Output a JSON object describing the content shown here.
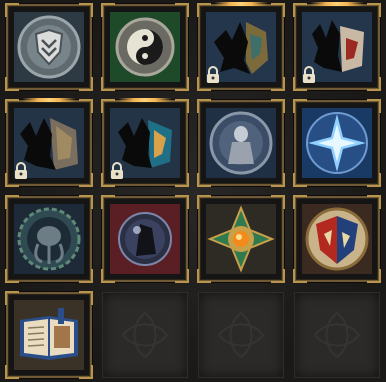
{
  "collection": {
    "slots": [
      {
        "icon": "shield-emblem-icon",
        "locked": false
      },
      {
        "icon": "yin-yang-icon",
        "locked": false
      },
      {
        "icon": "dragon-silhouette-icon",
        "locked": true
      },
      {
        "icon": "flame-silhouette-icon",
        "locked": true
      },
      {
        "icon": "winged-silhouette-icon",
        "locked": true
      },
      {
        "icon": "crystal-silhouette-icon",
        "locked": true
      },
      {
        "icon": "stone-guardian-icon",
        "locked": false
      },
      {
        "icon": "ice-star-icon",
        "locked": false
      },
      {
        "icon": "tentacle-beast-icon",
        "locked": false
      },
      {
        "icon": "dark-orb-icon",
        "locked": false
      },
      {
        "icon": "ornate-amber-icon",
        "locked": false
      },
      {
        "icon": "heraldic-crest-icon",
        "locked": false
      },
      {
        "icon": "open-book-icon",
        "locked": false
      }
    ],
    "empty_slots": 3
  },
  "colors": {
    "frame_gold": "#b8944c",
    "glow": "#f2b451",
    "empty_slot": "#2b2a28"
  }
}
